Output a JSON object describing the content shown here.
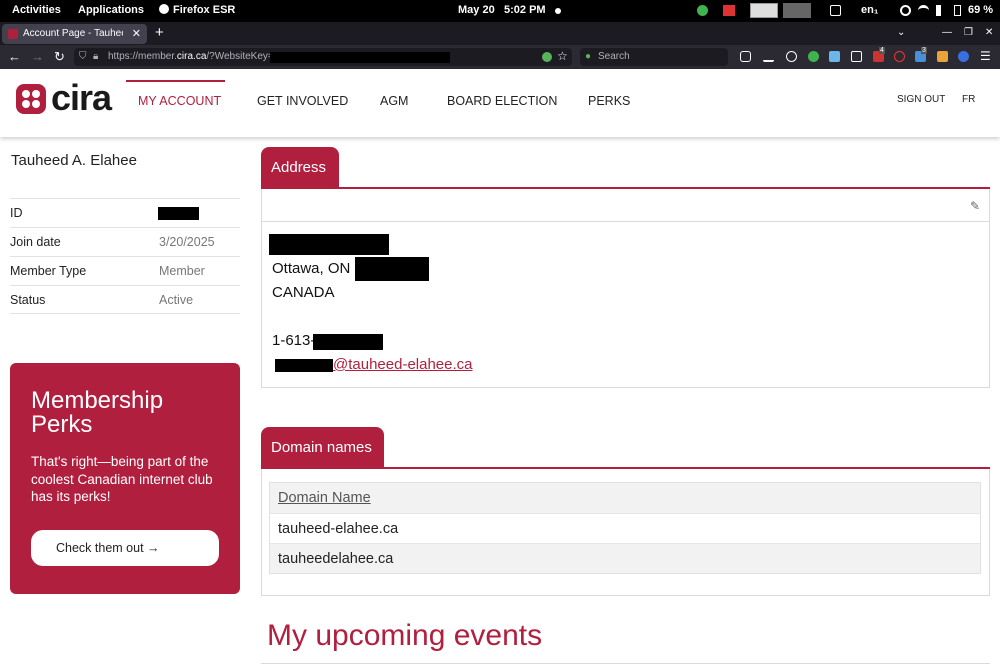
{
  "system": {
    "activities": "Activities",
    "applications": "Applications",
    "app_name": "Firefox ESR",
    "date": "May 20",
    "time": "5:02 PM",
    "keyboard": "en₁",
    "battery": "69 %"
  },
  "browser": {
    "tab_title": "Account Page - Tauheed A. Elahee",
    "new_tab": "+",
    "url_prefix": "https://member.",
    "url_domain": "cira.ca",
    "url_suffix": "/?WebsiteKey=",
    "search_placeholder": "Search",
    "badge_1": "4",
    "badge_2": "3"
  },
  "site": {
    "logo_text": "cira",
    "nav": [
      "MY ACCOUNT",
      "GET INVOLVED",
      "AGM",
      "BOARD ELECTION",
      "PERKS"
    ],
    "sign_out": "SIGN OUT",
    "lang": "FR"
  },
  "member": {
    "name": "Tauheed A. Elahee",
    "rows": [
      {
        "label": "ID",
        "value": ""
      },
      {
        "label": "Join date",
        "value": "3/20/2025"
      },
      {
        "label": "Member Type",
        "value": "Member"
      },
      {
        "label": "Status",
        "value": "Active"
      }
    ]
  },
  "perks": {
    "title": "Membership Perks",
    "text": "That's right—being part of the coolest Canadian internet club has its perks!",
    "button": "Check them out →"
  },
  "address": {
    "tab": "Address",
    "city_line": "Ottawa, ON",
    "country": "CANADA",
    "phone_prefix": "1-613-",
    "email_domain": "@tauheed-elahee.ca"
  },
  "domains": {
    "tab": "Domain names",
    "header": "Domain Name",
    "rows": [
      "tauheed-elahee.ca",
      "tauheedelahee.ca"
    ]
  },
  "events": {
    "title": "My upcoming events"
  }
}
